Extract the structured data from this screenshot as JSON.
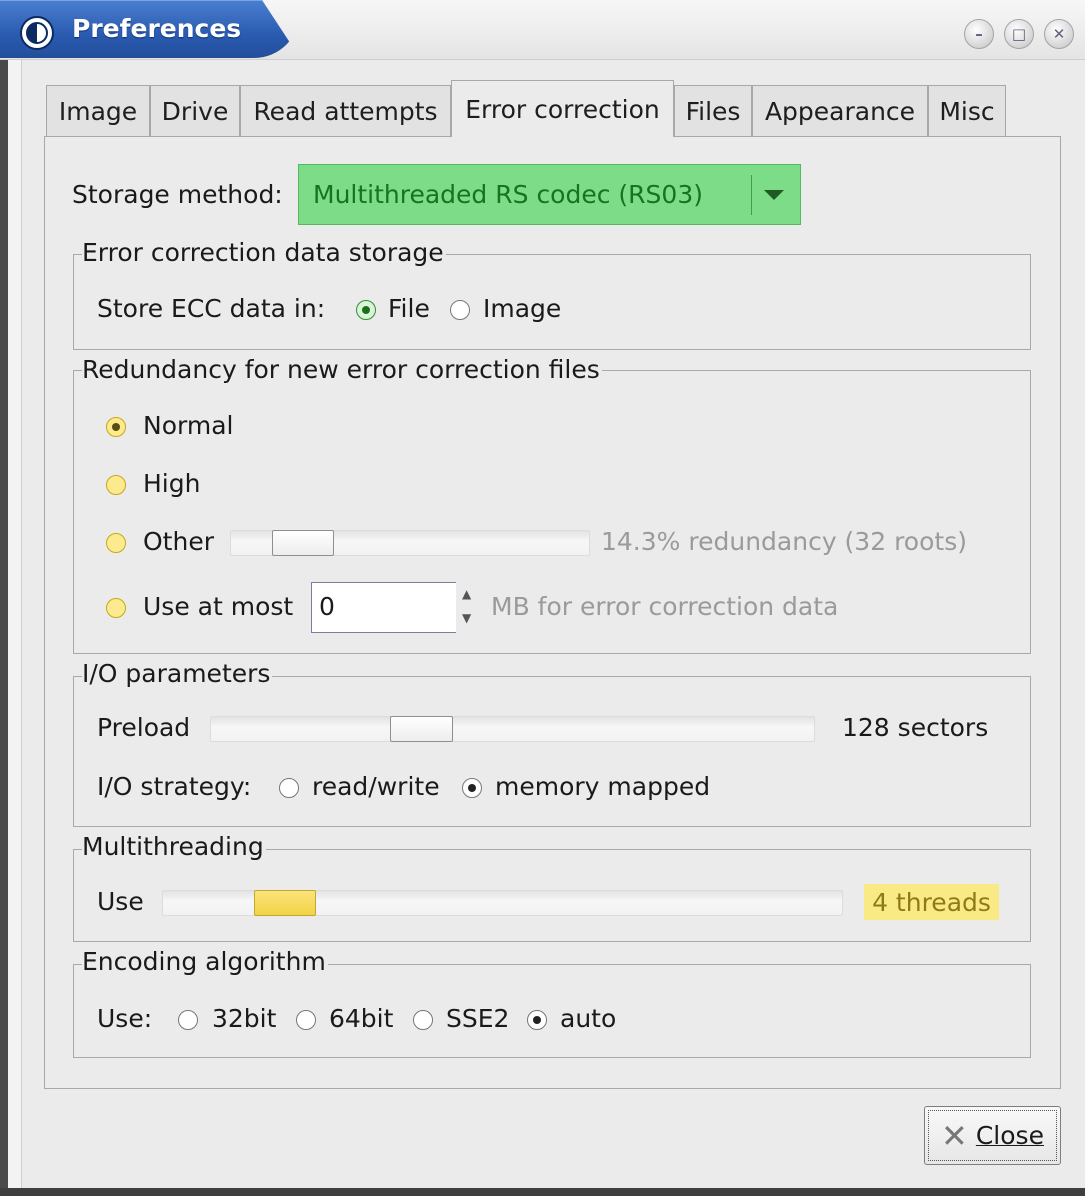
{
  "window": {
    "title": "Preferences",
    "controls": [
      "minimize-icon",
      "maximize-icon",
      "close-icon"
    ]
  },
  "tabs": [
    {
      "label": "Image",
      "active": false
    },
    {
      "label": "Drive",
      "active": false
    },
    {
      "label": "Read attempts",
      "active": false
    },
    {
      "label": "Error correction",
      "active": true
    },
    {
      "label": "Files",
      "active": false
    },
    {
      "label": "Appearance",
      "active": false
    },
    {
      "label": "Misc",
      "active": false
    }
  ],
  "storage": {
    "label": "Storage method:",
    "value": "Multithreaded RS codec (RS03)",
    "color": "#7ddc88"
  },
  "ecc_storage": {
    "title": "Error correction data storage",
    "label": "Store ECC data in:",
    "options": [
      "File",
      "Image"
    ],
    "selected": "File"
  },
  "redundancy": {
    "title": "Redundancy for new error correction files",
    "normal": "Normal",
    "high": "High",
    "other": "Other",
    "other_value": "14.3% redundancy (32 roots)",
    "use_at_most": "Use at most",
    "spin_value": "0",
    "spin_suffix": "MB for error correction data",
    "selected": "Normal"
  },
  "io": {
    "title": "I/O parameters",
    "preload_label": "Preload",
    "preload_value": "128 sectors",
    "strategy_label": "I/O strategy:",
    "strategies": [
      "read/write",
      "memory mapped"
    ],
    "selected": "memory mapped"
  },
  "multithreading": {
    "title": "Multithreading",
    "use_label": "Use",
    "value": "4 threads"
  },
  "encoding": {
    "title": "Encoding algorithm",
    "use_label": "Use:",
    "options": [
      "32bit",
      "64bit",
      "SSE2",
      "auto"
    ],
    "selected": "auto"
  },
  "close_button": {
    "label": "Close",
    "icon": "close-x-icon"
  }
}
